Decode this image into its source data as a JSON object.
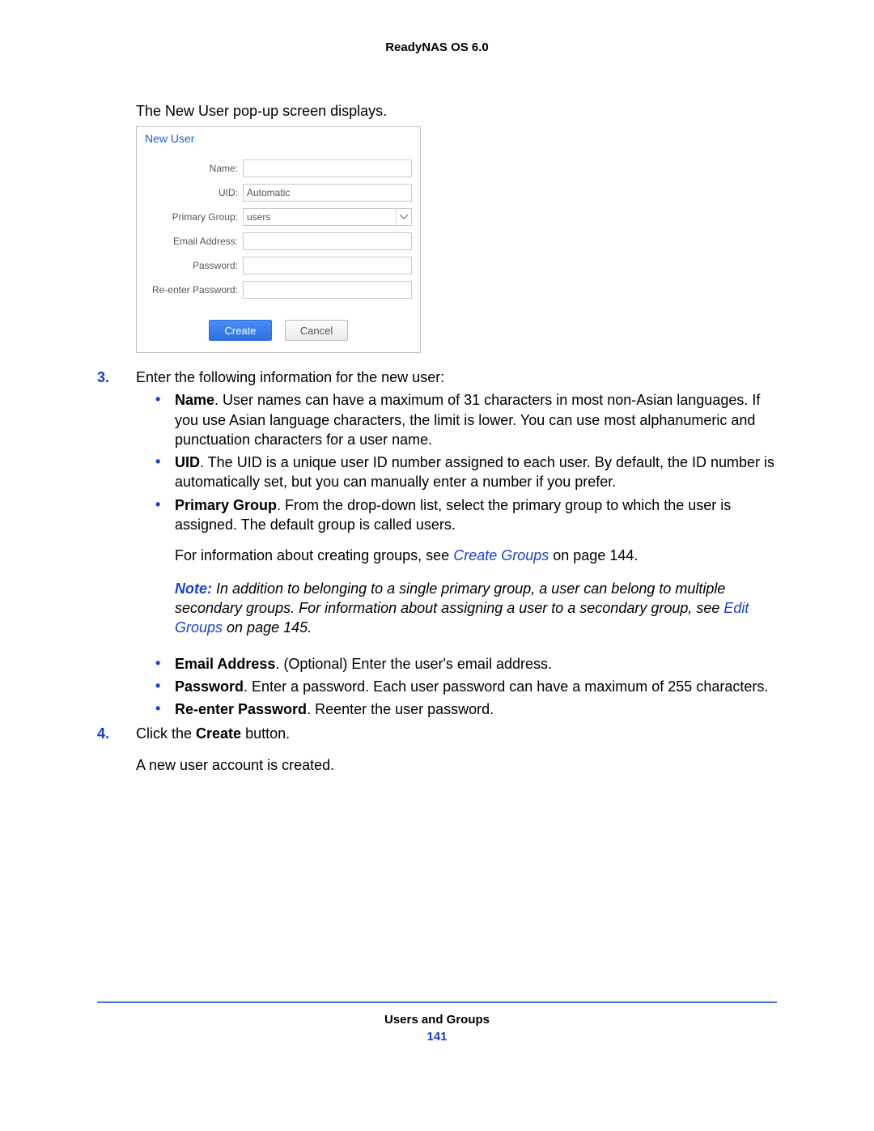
{
  "header": {
    "title": "ReadyNAS OS 6.0"
  },
  "intro": "The New User pop-up screen displays.",
  "dialog": {
    "title": "New User",
    "fields": {
      "name_label": "Name:",
      "uid_label": "UID:",
      "uid_value": "Automatic",
      "primary_group_label": "Primary Group:",
      "primary_group_value": "users",
      "email_label": "Email Address:",
      "password_label": "Password:",
      "reenter_label": "Re-enter Password:"
    },
    "buttons": {
      "create": "Create",
      "cancel": "Cancel"
    }
  },
  "steps": {
    "s3": {
      "num": "3.",
      "lead": "Enter the following information for the new user:",
      "bullets": {
        "name": {
          "term": "Name",
          "text": ". User names can have a maximum of 31 characters in most non-Asian languages. If you use Asian language characters, the limit is lower. You can use most alphanumeric and punctuation characters for a user name."
        },
        "uid": {
          "term": "UID",
          "text": ". The UID is a unique user ID number assigned to each user. By default, the ID number is automatically set, but you can manually enter a number if you prefer."
        },
        "pgroup": {
          "term": "Primary Group",
          "text": ". From the drop-down list, select the primary group to which the user is assigned. The default group is called users."
        },
        "pgroup_more_pre": "For information about creating groups, see ",
        "pgroup_more_link": "Create Groups",
        "pgroup_more_post": " on page 144.",
        "note_label": "Note:  ",
        "note_text_pre": "In addition to belonging to a single primary group, a user can belong to multiple secondary groups. For information about assigning a user to a secondary group, see ",
        "note_link": "Edit Groups",
        "note_text_post": " on page 145.",
        "email": {
          "term": "Email Address",
          "text": ". (Optional) Enter the user's email address."
        },
        "password": {
          "term": "Password",
          "text": ". Enter a password. Each user password can have a maximum of 255 characters."
        },
        "repassword": {
          "term": "Re-enter Password",
          "text": ". Reenter the user password."
        }
      }
    },
    "s4": {
      "num": "4.",
      "pre": "Click the ",
      "bold": "Create",
      "post": " button.",
      "result": "A new user account is created."
    }
  },
  "footer": {
    "section": "Users and Groups",
    "page": "141"
  }
}
